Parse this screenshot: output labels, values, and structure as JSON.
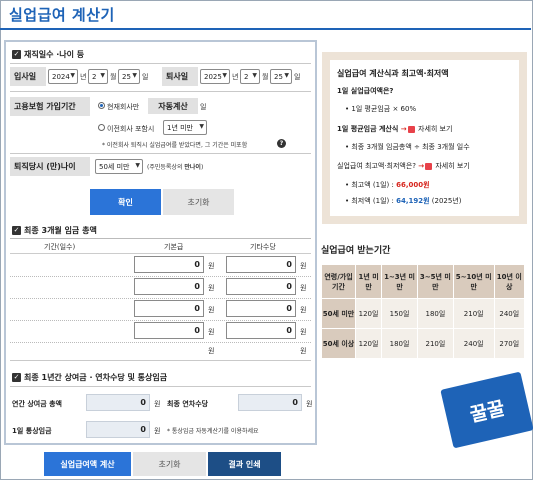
{
  "app": {
    "title": "실업급여 계산기"
  },
  "sec1": {
    "title": "재직일수 ·나이 등",
    "join_label": "입사일",
    "join": {
      "year": "2024",
      "year_unit": "년",
      "month": "2",
      "month_unit": "월",
      "day": "25",
      "day_unit": "일"
    },
    "leave_label": "퇴사일",
    "leave": {
      "year": "2025",
      "year_unit": "년",
      "month": "2",
      "month_unit": "월",
      "day": "25",
      "day_unit": "일"
    },
    "ins_label": "고용보험 가입기간",
    "opt_current": "현재회사만",
    "auto_value": "자동계산",
    "auto_unit": "일",
    "opt_prev": "이전회사 포함시",
    "prev_select": "1년 미만",
    "note": "* 이전회사 퇴직시 실업급여를 받았다면, 그 기간은 미포함",
    "age_label": "퇴직당시 (만)나이",
    "age_select": "50세 미만",
    "age_note_prefix": "(주민등록상의 ",
    "age_note_bold": "만나이",
    "age_note_suffix": ")",
    "confirm": "확인",
    "reset": "초기화"
  },
  "sec2": {
    "title": "최종 3개월 임금 총액",
    "headers": [
      "기간(일수)",
      "기본급",
      "기타수당"
    ],
    "rows": [
      {
        "basic": "0",
        "other": "0"
      },
      {
        "basic": "0",
        "other": "0"
      },
      {
        "basic": "0",
        "other": "0"
      },
      {
        "basic": "0",
        "other": "0"
      }
    ],
    "unit": "원"
  },
  "sec3": {
    "title": "최종 1년간 상여금 · 연차수당 및 통상임금",
    "bonus_label": "연간 상여금 총액",
    "bonus_value": "0",
    "leave_pay_label": "최종 연차수당",
    "leave_pay_value": "0",
    "wage_label": "1일 통상임금",
    "wage_value": "0",
    "wage_note": "* 통상임금 자동계산기를 이용하세요",
    "unit": "원"
  },
  "bottom": {
    "calc": "실업급여액 계산",
    "reset": "초기화",
    "print": "결과 인쇄"
  },
  "info": {
    "title": "실업급여 계산식과 최고액·최저액",
    "q1": "1일 실업급여액은?",
    "a1": "1일 평균임금 × 60%",
    "q2": "1일 평균임금 계산식",
    "more": "자세히 보기",
    "a2": "최종 3개월 임금총액 ÷ 최종 3개월 일수",
    "q3": "실업급여 최고액·최저액은?",
    "max_label": "최고액 (1일) : ",
    "max_value": "66,000원",
    "min_label": "최저액 (1일) : ",
    "min_value": "64,192원",
    "min_suffix": " (2025년)"
  },
  "period": {
    "title": "실업급여 받는기간",
    "header": [
      "연령/가입기간",
      "1년 미만",
      "1~3년 미만",
      "3~5년 미만",
      "5~10년 미만",
      "10년 이상"
    ],
    "rows": [
      {
        "label": "50세 미만",
        "values": [
          "120일",
          "150일",
          "180일",
          "210일",
          "240일"
        ]
      },
      {
        "label": "50세 이상",
        "values": [
          "120일",
          "180일",
          "210일",
          "240일",
          "270일"
        ]
      }
    ]
  },
  "badge": {
    "text": "꿀꿀"
  },
  "colors": {
    "accent": "#1e63b7",
    "navy": "#1d4e86",
    "beige": "#ede3d7"
  }
}
